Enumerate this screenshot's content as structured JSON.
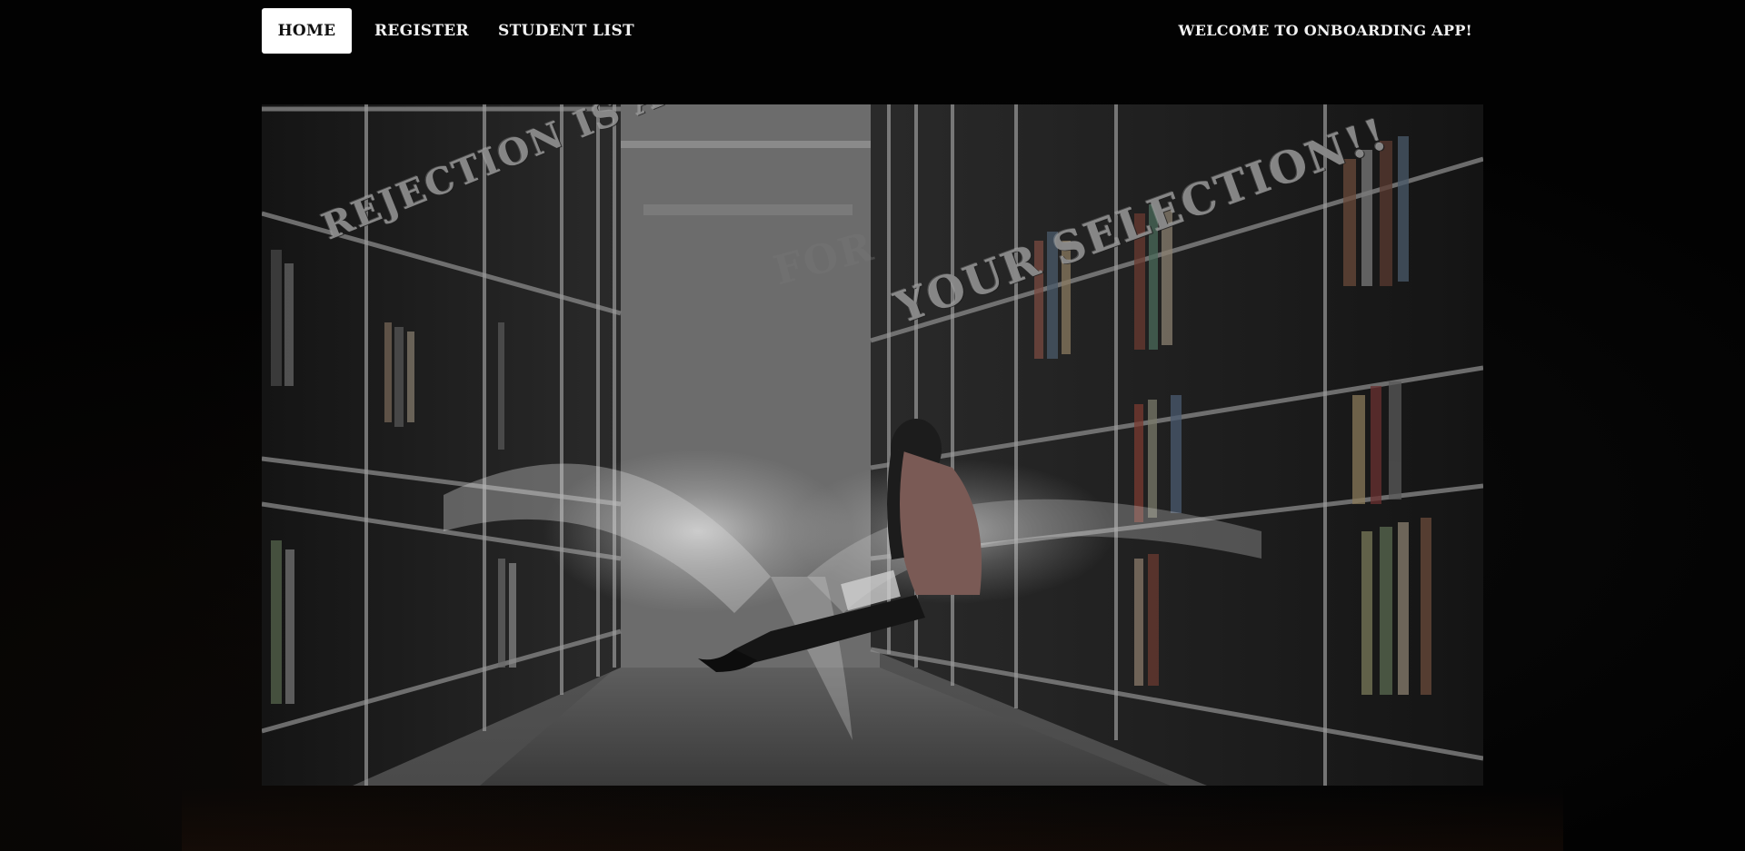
{
  "nav": {
    "home_label": "HOME",
    "register_label": "REGISTER",
    "student_list_label": "STUDENT LIST",
    "welcome_text": "WELCOME TO ONBOARDING APP!"
  },
  "hero": {
    "line1": "REJECTION IS AN OPPORTUNITY!!",
    "line2_faint": "FOR",
    "line3": "YOUR SELECTION!!",
    "image_description_icon": "library-reading-image"
  },
  "colors": {
    "background": "#020202",
    "nav_active_bg": "#ffffff",
    "nav_text": "#f2f2f2"
  }
}
